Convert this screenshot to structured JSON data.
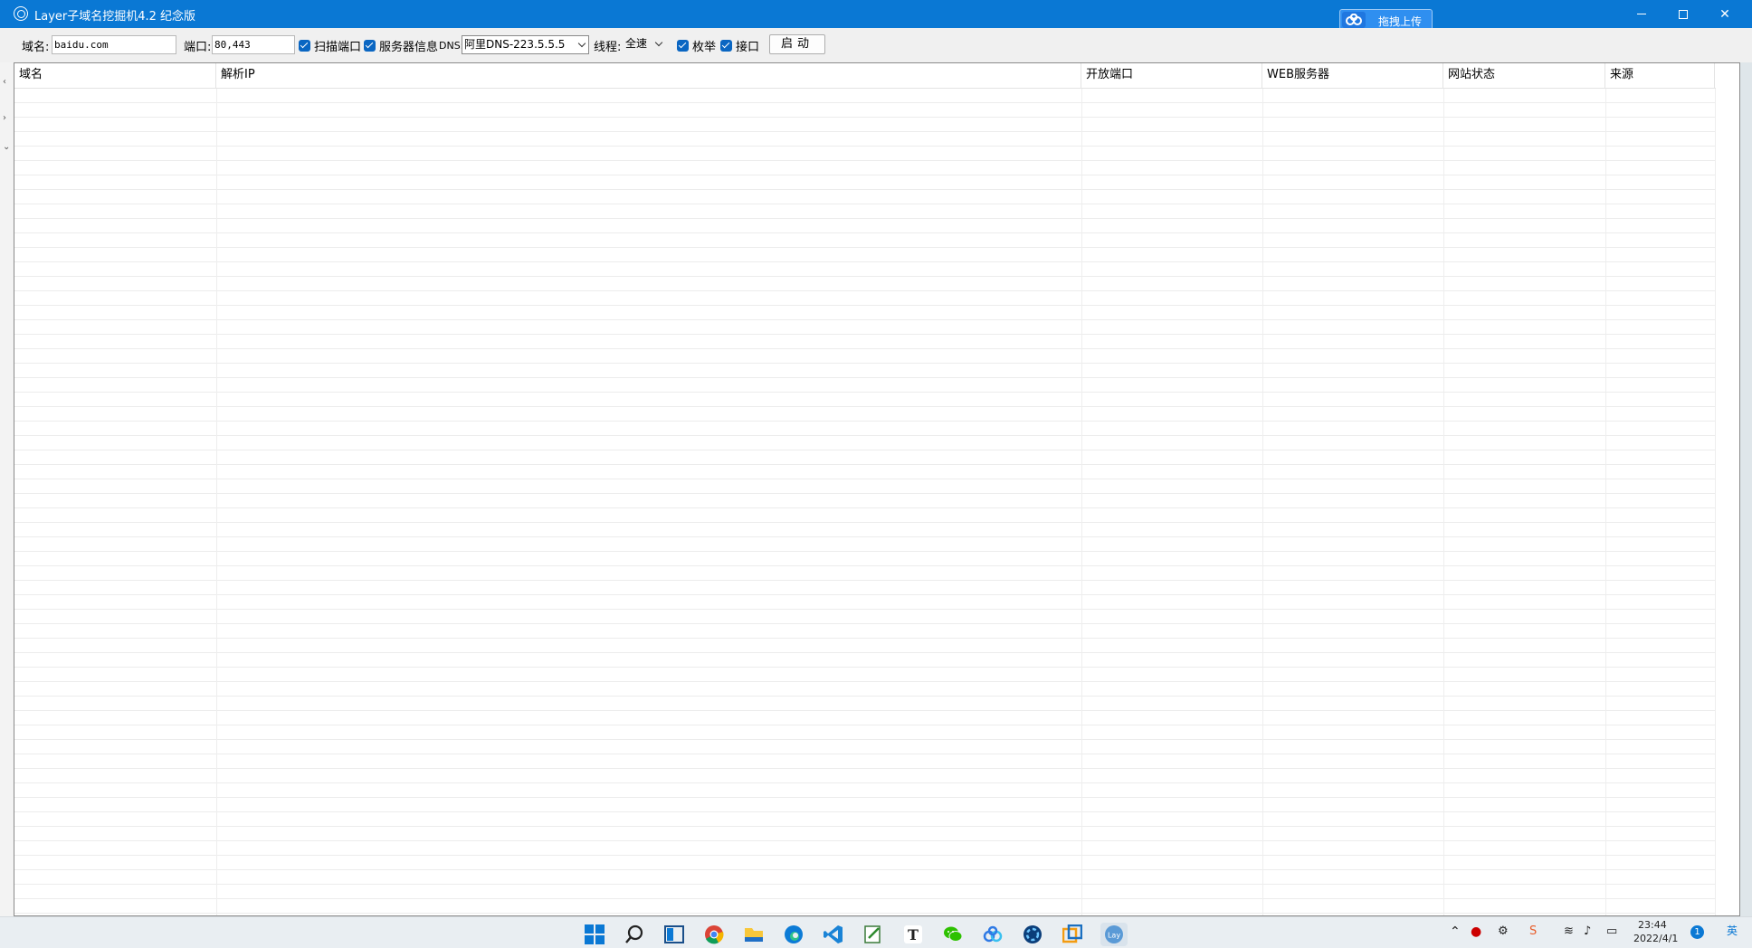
{
  "window": {
    "title": "Layer子域名挖掘机4.2 纪念版",
    "upload_label": "拖拽上传"
  },
  "toolbar": {
    "domain_label": "域名:",
    "domain_value": "baidu.com",
    "port_label": "端口:",
    "port_value": "80,443",
    "scan_ports_label": "扫描端口",
    "server_info_label": "服务器信息",
    "dns_label": "DNS:",
    "dns_value": "阿里DNS-223.5.5.5",
    "threads_label": "线程:",
    "threads_value": "全速",
    "enumerate_label": "枚举",
    "api_label": "接口",
    "start_label": "启动"
  },
  "grid": {
    "columns": [
      "域名",
      "解析IP",
      "开放端口",
      "WEB服务器",
      "网站状态",
      "来源"
    ],
    "rows": []
  },
  "taskbar": {
    "apps": [
      "start-icon",
      "search-icon",
      "task-view-icon",
      "chrome-icon",
      "file-explorer-icon",
      "edge-icon",
      "vscode-icon",
      "notepad-icon",
      "typora-icon",
      "wechat-icon",
      "baidu-netdisk-icon",
      "app-icon",
      "vmware-icon",
      "layer-icon"
    ],
    "time": "23:44",
    "date": "2022/4/1",
    "notification_count": "1"
  }
}
